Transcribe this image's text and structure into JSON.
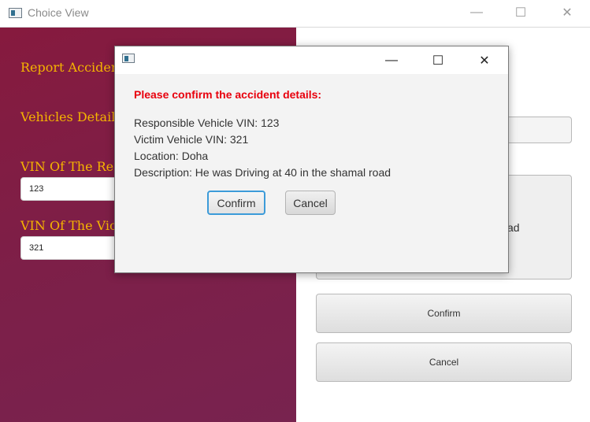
{
  "main_window": {
    "title": "Choice View",
    "controls": {
      "minimize": "—",
      "maximize": "☐",
      "close": "✕"
    }
  },
  "left_panel": {
    "report_accident_label": "Report Accident",
    "vehicles_details_label": "Vehicles Details",
    "responsible_vin_label": "VIN Of The Responsible Vehicle",
    "responsible_vin_value": "123",
    "victim_vin_label": "VIN Of The Victim Vehicle",
    "victim_vin_value": "321"
  },
  "right_panel": {
    "description_visible_fragment": "ad",
    "confirm_button": "Confirm",
    "cancel_button": "Cancel"
  },
  "dialog": {
    "controls": {
      "minimize": "—",
      "maximize": "☐",
      "close": "✕"
    },
    "heading": "Please confirm the accident details:",
    "lines": [
      "Responsible Vehicle VIN: 123",
      "Victim Vehicle VIN: 321",
      "Location: Doha",
      "Description: He was Driving at 40 in the shamal road"
    ],
    "confirm_button": "Confirm",
    "cancel_button": "Cancel"
  },
  "colors": {
    "panel_gradient_start": "#861a3e",
    "panel_gradient_end": "#78234f",
    "label_color": "#f5b400",
    "heading_color": "#e8000d",
    "focus_border": "#3c9bd9"
  }
}
